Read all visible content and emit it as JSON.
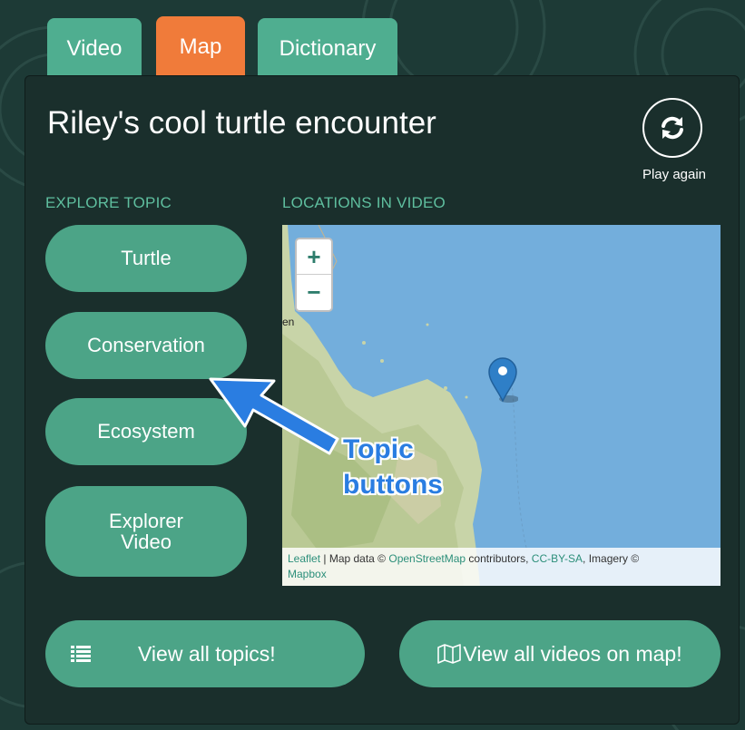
{
  "tabs": [
    {
      "label": "Video"
    },
    {
      "label": "Map",
      "active": true
    },
    {
      "label": "Dictionary"
    }
  ],
  "title": "Riley's cool turtle encounter",
  "replay": {
    "label": "Play again",
    "icon": "refresh-icon"
  },
  "sections": {
    "explore": "EXPLORE TOPIC",
    "locations": "LOCATIONS IN VIDEO"
  },
  "topics": [
    {
      "label": "Turtle"
    },
    {
      "label": "Conservation"
    },
    {
      "label": "Ecosystem"
    },
    {
      "label": "Explorer Video"
    }
  ],
  "map": {
    "zoom_in": "+",
    "zoom_out": "−",
    "place_fragment": "en",
    "attribution": {
      "leaflet": "Leaflet",
      "sep1": " | Map data © ",
      "osm": "OpenStreetMap",
      "contrib": " contributors, ",
      "license": "CC-BY-SA",
      "imagery": ", Imagery ©",
      "mapbox": "Mapbox"
    }
  },
  "buttons": {
    "topics": "View all topics!",
    "videos": "View all videos on map!"
  },
  "annotation": {
    "line1": "Topic",
    "line2": "buttons"
  },
  "colors": {
    "background": "#1d3a36",
    "panel": "#1a2f2c",
    "accent_green": "#4ca487",
    "tab_active": "#f07b3a",
    "label_green": "#5fbf9f",
    "annotation_blue": "#2a7de1"
  }
}
